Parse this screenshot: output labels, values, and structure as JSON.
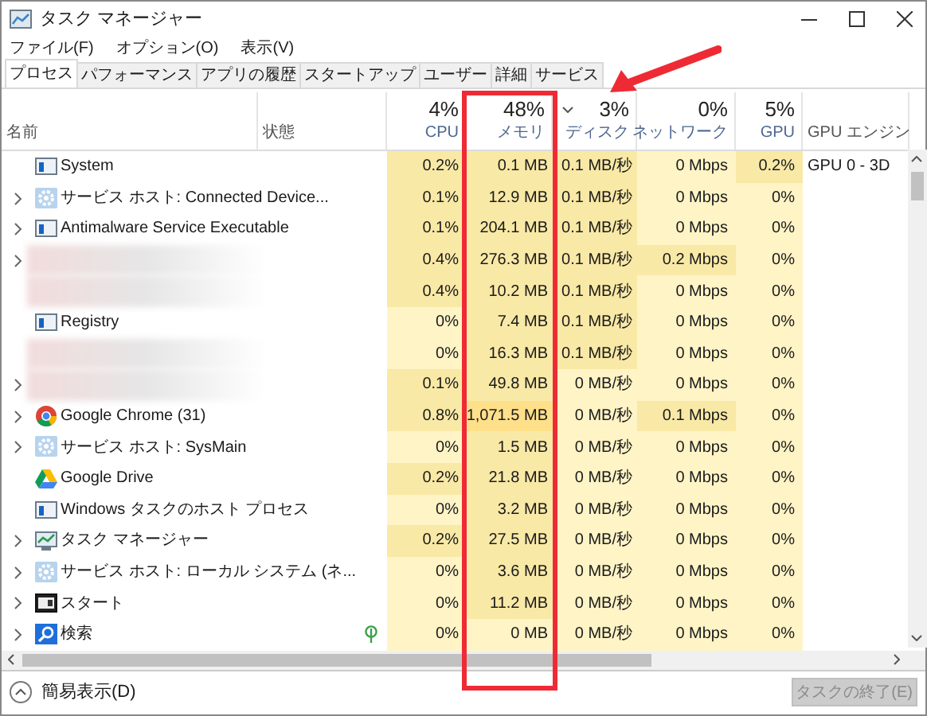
{
  "window": {
    "title": "タスク マネージャー"
  },
  "menu": [
    "ファイル(F)",
    "オプション(O)",
    "表示(V)"
  ],
  "tabs": [
    {
      "label": "プロセス",
      "selected": true
    },
    {
      "label": "パフォーマンス",
      "selected": false
    },
    {
      "label": "アプリの履歴",
      "selected": false
    },
    {
      "label": "スタートアップ",
      "selected": false
    },
    {
      "label": "ユーザー",
      "selected": false
    },
    {
      "label": "詳細",
      "selected": false
    },
    {
      "label": "サービス",
      "selected": false
    }
  ],
  "columns": [
    {
      "label": "名前"
    },
    {
      "label": "状態"
    },
    {
      "percent": "4%",
      "label": "CPU"
    },
    {
      "percent": "48%",
      "label": "メモリ"
    },
    {
      "percent": "3%",
      "label": "ディスク",
      "sort_indicator": true
    },
    {
      "percent": "0%",
      "label": "ネットワーク"
    },
    {
      "percent": "5%",
      "label": "GPU"
    },
    {
      "label": "GPU エンジン"
    }
  ],
  "rows": [
    {
      "kind": "window",
      "name": "System",
      "expandable": false,
      "suspended": false,
      "cells": [
        "0.2%",
        "0.1 MB",
        "0.1 MB/秒",
        "0 Mbps",
        "0.2%"
      ],
      "gpu_engine": "GPU 0 - 3D"
    },
    {
      "kind": "gear",
      "name": "サービス ホスト: Connected Device...",
      "expandable": true,
      "suspended": false,
      "cells": [
        "0.1%",
        "12.9 MB",
        "0.1 MB/秒",
        "0 Mbps",
        "0%"
      ]
    },
    {
      "kind": "window",
      "name": "Antimalware Service Executable",
      "expandable": true,
      "suspended": false,
      "cells": [
        "0.1%",
        "204.1 MB",
        "0.1 MB/秒",
        "0 Mbps",
        "0%"
      ]
    },
    {
      "kind": "blurred",
      "expandable": true,
      "suspended": false,
      "cells": [
        "0.4%",
        "276.3 MB",
        "0.1 MB/秒",
        "0.2 Mbps",
        "0%"
      ]
    },
    {
      "kind": "blurred",
      "expandable": false,
      "suspended": false,
      "cells": [
        "0.4%",
        "10.2 MB",
        "0.1 MB/秒",
        "0 Mbps",
        "0%"
      ]
    },
    {
      "kind": "window",
      "name": "Registry",
      "expandable": false,
      "suspended": false,
      "cells": [
        "0%",
        "7.4 MB",
        "0.1 MB/秒",
        "0 Mbps",
        "0%"
      ]
    },
    {
      "kind": "blurred",
      "expandable": false,
      "suspended": false,
      "cells": [
        "0%",
        "16.3 MB",
        "0.1 MB/秒",
        "0 Mbps",
        "0%"
      ]
    },
    {
      "kind": "blurred",
      "expandable": true,
      "suspended": false,
      "cells": [
        "0.1%",
        "49.8 MB",
        "0 MB/秒",
        "0 Mbps",
        "0%"
      ]
    },
    {
      "kind": "chrome",
      "name": "Google Chrome (31)",
      "expandable": true,
      "suspended": false,
      "cells": [
        "0.8%",
        "1,071.5 MB",
        "0 MB/秒",
        "0.1 Mbps",
        "0%"
      ]
    },
    {
      "kind": "gear",
      "name": "サービス ホスト: SysMain",
      "expandable": true,
      "suspended": false,
      "cells": [
        "0%",
        "1.5 MB",
        "0 MB/秒",
        "0 Mbps",
        "0%"
      ]
    },
    {
      "kind": "drive",
      "name": "Google Drive",
      "expandable": false,
      "suspended": false,
      "cells": [
        "0.2%",
        "21.8 MB",
        "0 MB/秒",
        "0 Mbps",
        "0%"
      ]
    },
    {
      "kind": "window",
      "name": "Windows タスクのホスト プロセス",
      "expandable": false,
      "suspended": false,
      "cells": [
        "0%",
        "3.2 MB",
        "0 MB/秒",
        "0 Mbps",
        "0%"
      ]
    },
    {
      "kind": "monitor",
      "name": "タスク マネージャー",
      "expandable": true,
      "suspended": false,
      "cells": [
        "0.2%",
        "27.5 MB",
        "0 MB/秒",
        "0 Mbps",
        "0%"
      ]
    },
    {
      "kind": "gear",
      "name": "サービス ホスト: ローカル システム (ネ...",
      "expandable": true,
      "suspended": false,
      "cells": [
        "0%",
        "3.6 MB",
        "0 MB/秒",
        "0 Mbps",
        "0%"
      ]
    },
    {
      "kind": "dark-window",
      "name": "スタート",
      "expandable": true,
      "suspended": false,
      "cells": [
        "0%",
        "11.2 MB",
        "0 MB/秒",
        "0 Mbps",
        "0%"
      ]
    },
    {
      "kind": "search",
      "name": "検索",
      "expandable": true,
      "suspended": true,
      "cells": [
        "0%",
        "0 MB",
        "0 MB/秒",
        "0 Mbps",
        "0%"
      ]
    }
  ],
  "footer": {
    "toggle": "簡易表示(D)",
    "end_task": {
      "label": "タスクの終了(E)",
      "disabled": true
    }
  }
}
